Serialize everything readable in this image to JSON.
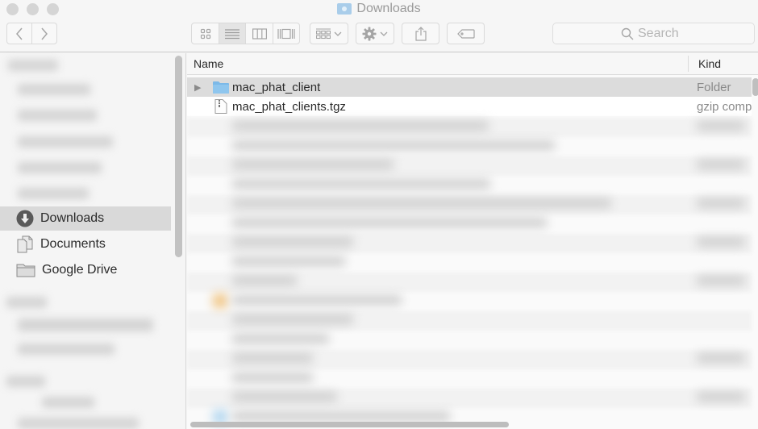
{
  "window": {
    "title": "Downloads",
    "title_icon": "downloads-folder-icon"
  },
  "toolbar": {
    "back_icon": "chevron-left-icon",
    "forward_icon": "chevron-right-icon",
    "view_modes": [
      {
        "id": "icon",
        "icon": "icon-view-icon",
        "active": false
      },
      {
        "id": "list",
        "icon": "list-view-icon",
        "active": true
      },
      {
        "id": "column",
        "icon": "column-view-icon",
        "active": false
      },
      {
        "id": "gallery",
        "icon": "cover-flow-icon",
        "active": false
      }
    ],
    "arrange_icon": "arrange-grid-icon",
    "action_icon": "gear-icon",
    "share_icon": "share-icon",
    "tag_icon": "tag-icon",
    "search_placeholder": "Search"
  },
  "sidebar": {
    "items": [
      {
        "label": "Downloads",
        "icon": "downloads-icon",
        "selected": true
      },
      {
        "label": "Documents",
        "icon": "documents-icon",
        "selected": false
      },
      {
        "label": "Google Drive",
        "icon": "folder-icon",
        "selected": false
      }
    ]
  },
  "file_list": {
    "columns": {
      "name": "Name",
      "kind": "Kind"
    },
    "rows": [
      {
        "name": "mac_phat_client",
        "kind": "Folder",
        "type": "folder",
        "expandable": true,
        "selected": true
      },
      {
        "name": "mac_phat_clients.tgz",
        "kind": "gzip compressed archive",
        "type": "archive",
        "expandable": false,
        "selected": false
      }
    ]
  },
  "colors": {
    "selection": "#dcdcdc",
    "folder_blue": "#7cb9e8",
    "toolbar_icon": "#a5a5a5"
  }
}
